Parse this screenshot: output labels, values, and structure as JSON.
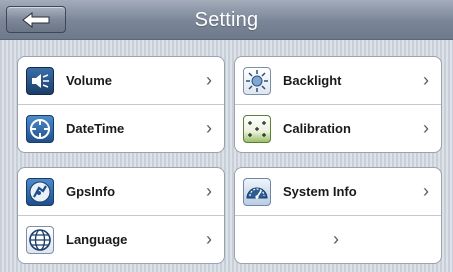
{
  "header": {
    "title": "Setting",
    "back_icon": "back-arrow-icon"
  },
  "panels": {
    "top_left": {
      "items": [
        {
          "label": "Volume",
          "icon": "speaker-icon"
        },
        {
          "label": "DateTime",
          "icon": "clock-icon"
        }
      ]
    },
    "top_right": {
      "items": [
        {
          "label": "Backlight",
          "icon": "brightness-icon"
        },
        {
          "label": "Calibration",
          "icon": "calibration-icon"
        }
      ]
    },
    "bottom_left": {
      "items": [
        {
          "label": "GpsInfo",
          "icon": "satellite-icon"
        },
        {
          "label": "Language",
          "icon": "globe-icon"
        }
      ]
    },
    "bottom_right": {
      "items": [
        {
          "label": "System Info",
          "icon": "dashboard-icon"
        },
        {
          "label": "",
          "icon": ""
        }
      ]
    }
  },
  "chevron": "›",
  "colors": {
    "header": "#7a8597",
    "panel_bg": "#ffffff",
    "text": "#1a1a1a",
    "chevron": "#555c66"
  }
}
